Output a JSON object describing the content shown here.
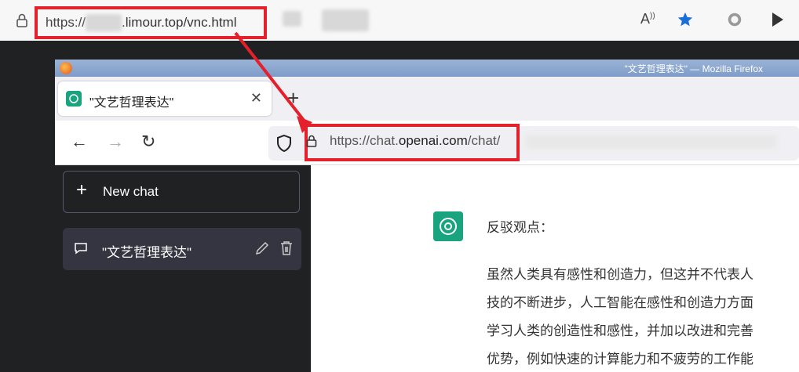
{
  "outer_browser": {
    "url_prefix": "https://",
    "url_domain": ".limour.top/vnc.html",
    "icons": [
      "lock-icon",
      "read-aloud-icon",
      "favorite-star-icon",
      "extension-icon",
      "play-icon"
    ]
  },
  "firefox": {
    "window_title": "\"文艺哲理表达\" — Mozilla Firefox",
    "tab_title": "\"文艺哲理表达\"",
    "url_prefix": "https://chat.",
    "url_domain": "openai.com",
    "url_path": "/chat/"
  },
  "sidebar": {
    "new_chat_label": "New chat",
    "items": [
      {
        "label": "\"文艺哲理表达\""
      }
    ]
  },
  "chat": {
    "lines": [
      "反驳观点：",
      "虽然人类具有感性和创造力，但这并不代表人",
      "技的不断进步，人工智能在感性和创造力方面",
      "学习人类的创造性和感性，并加以改进和完善",
      "优势，例如快速的计算能力和不疲劳的工作能"
    ]
  },
  "colors": {
    "annotation": "#e3202b",
    "gpt_green": "#19a37f",
    "sidebar_bg": "#202123"
  }
}
